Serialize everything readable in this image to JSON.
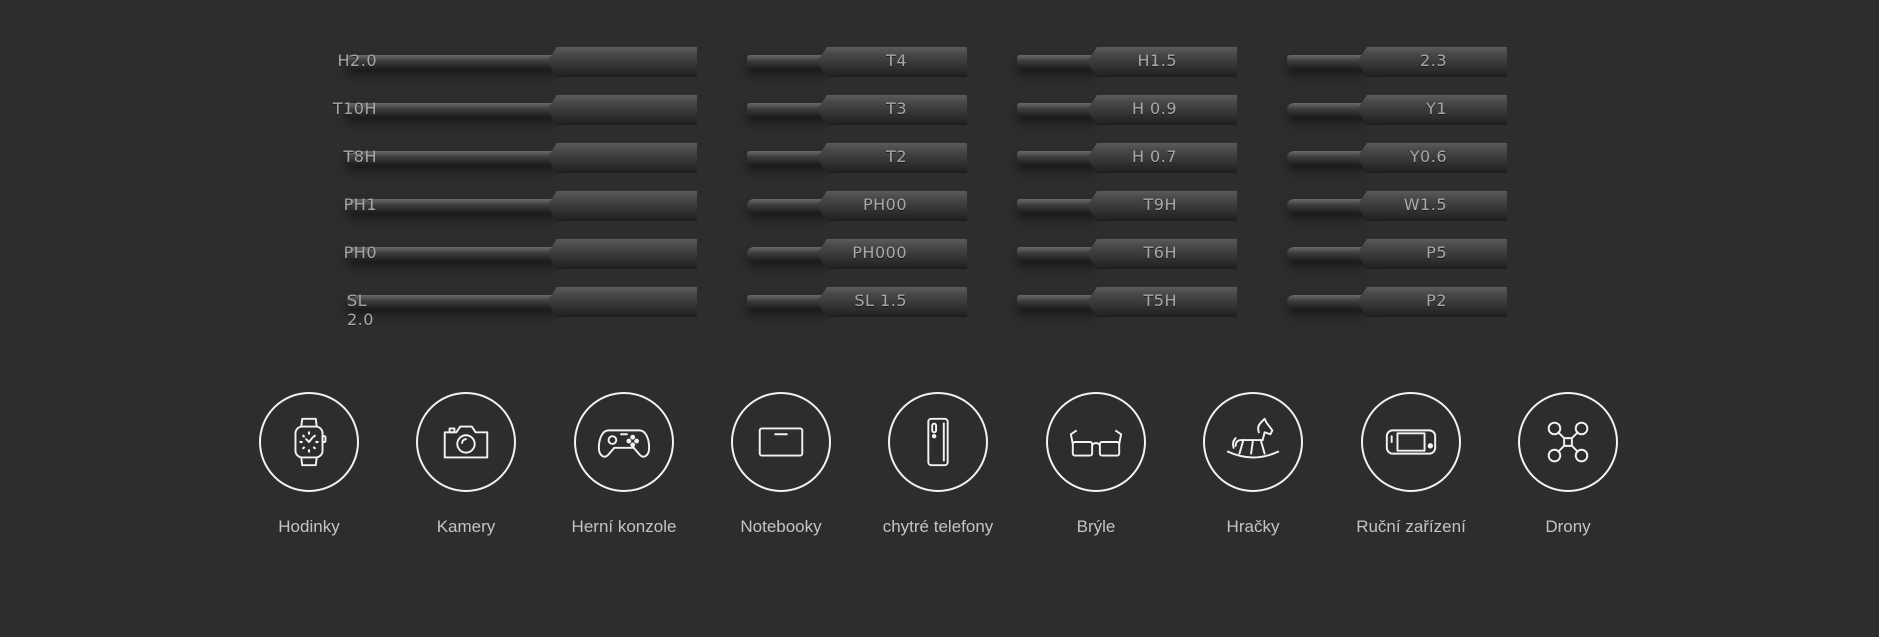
{
  "bits": {
    "columns": [
      {
        "labels": [
          "H2.0",
          "T10H",
          "T8H",
          "PH1",
          "PH0",
          "SL 2.0"
        ]
      },
      {
        "labels": [
          "T4",
          "T3",
          "T2",
          "PH00",
          "PH000",
          "SL 1.5"
        ]
      },
      {
        "labels": [
          "H1.5",
          "H 0.9",
          "H 0.7",
          "T9H",
          "T6H",
          "T5H"
        ]
      },
      {
        "labels": [
          "2.3",
          "Y1",
          "Y0.6",
          "W1.5",
          "P5",
          "P2"
        ]
      }
    ]
  },
  "devices": [
    {
      "label": "Hodinky",
      "icon": "watch-icon"
    },
    {
      "label": "Kamery",
      "icon": "camera-icon"
    },
    {
      "label": "Herní konzole",
      "icon": "gamepad-icon"
    },
    {
      "label": "Notebooky",
      "icon": "laptop-icon"
    },
    {
      "label": "chytré telefony",
      "icon": "smartphone-icon"
    },
    {
      "label": "Brýle",
      "icon": "glasses-icon"
    },
    {
      "label": "Hračky",
      "icon": "rocking-horse-icon"
    },
    {
      "label": "Ruční zařízení",
      "icon": "handheld-console-icon"
    },
    {
      "label": "Drony",
      "icon": "drone-icon"
    }
  ],
  "colors": {
    "background": "#2d2d2d",
    "icon_stroke": "#f2f2f2",
    "label": "#c4c4c4",
    "bit_label": "#a8a8a8"
  }
}
